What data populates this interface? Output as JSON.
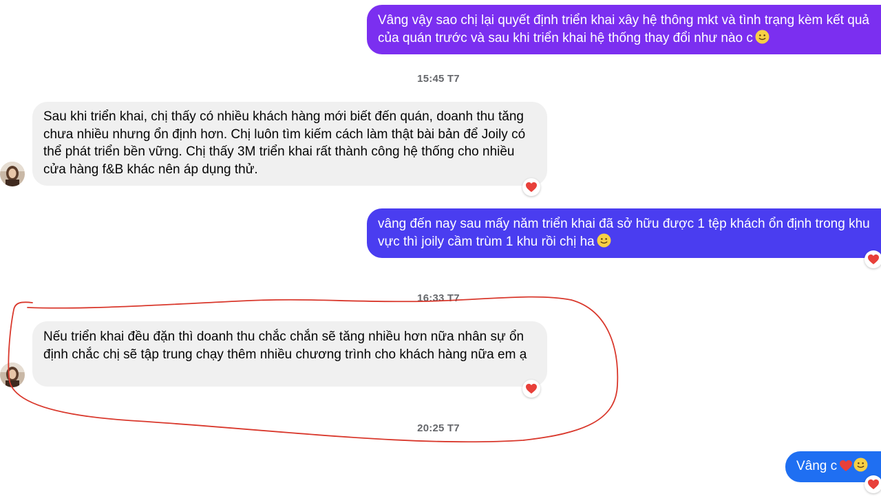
{
  "messages": [
    {
      "id": "m1",
      "direction": "outgoing",
      "text": "Vâng vậy sao chị lại quyết định triển khai xây hệ thông mkt và tình trạng kèm kết quả của quán trước và sau khi triển khai hệ thống thay đổi như nào c",
      "emoji": "slightly-smiling-face",
      "color": "#7b2ff0"
    },
    {
      "id": "m2",
      "direction": "incoming",
      "text": "Sau khi triển khai, chị thấy có nhiều khách hàng mới biết đến quán, doanh thu tăng chưa nhiều nhưng ổn định hơn. Chị luôn tìm kiếm cách làm thật bài bản để Joily có thể phát triển bền vững. Chị thấy 3M triển khai rất thành công hệ thống cho nhiều cửa hàng f&B khác nên áp dụng thử.",
      "reaction": "heart"
    },
    {
      "id": "m3",
      "direction": "outgoing",
      "text": "vâng đến nay sau mấy năm triển khai đã sở hữu được 1 tệp khách ổn định trong khu vực thì joily cầm trùm 1 khu rồi chị ha",
      "emoji": "slightly-smiling-face",
      "reaction": "heart",
      "color": "#4a3df0"
    },
    {
      "id": "m4",
      "direction": "incoming",
      "text": "Nếu triển khai đều đặn thì doanh thu chắc chắn sẽ tăng nhiều hơn nữa nhân sự ổn định chắc chị sẽ tập trung chạy thêm nhiều chương trình cho khách hàng nữa em ạ",
      "reaction": "heart"
    },
    {
      "id": "m5",
      "direction": "outgoing",
      "text": "Vâng c",
      "emoji": "heart-and-smile",
      "reaction": "heart",
      "color": "#1f6ff2"
    }
  ],
  "timestamps": [
    "15:45 T7",
    "16:33 T7",
    "20:25 T7"
  ],
  "colors": {
    "incoming_bubble": "#f0f0f0",
    "timestamp_text": "#65676b",
    "heart": "#e8403a",
    "annotation": "#d9382c"
  }
}
